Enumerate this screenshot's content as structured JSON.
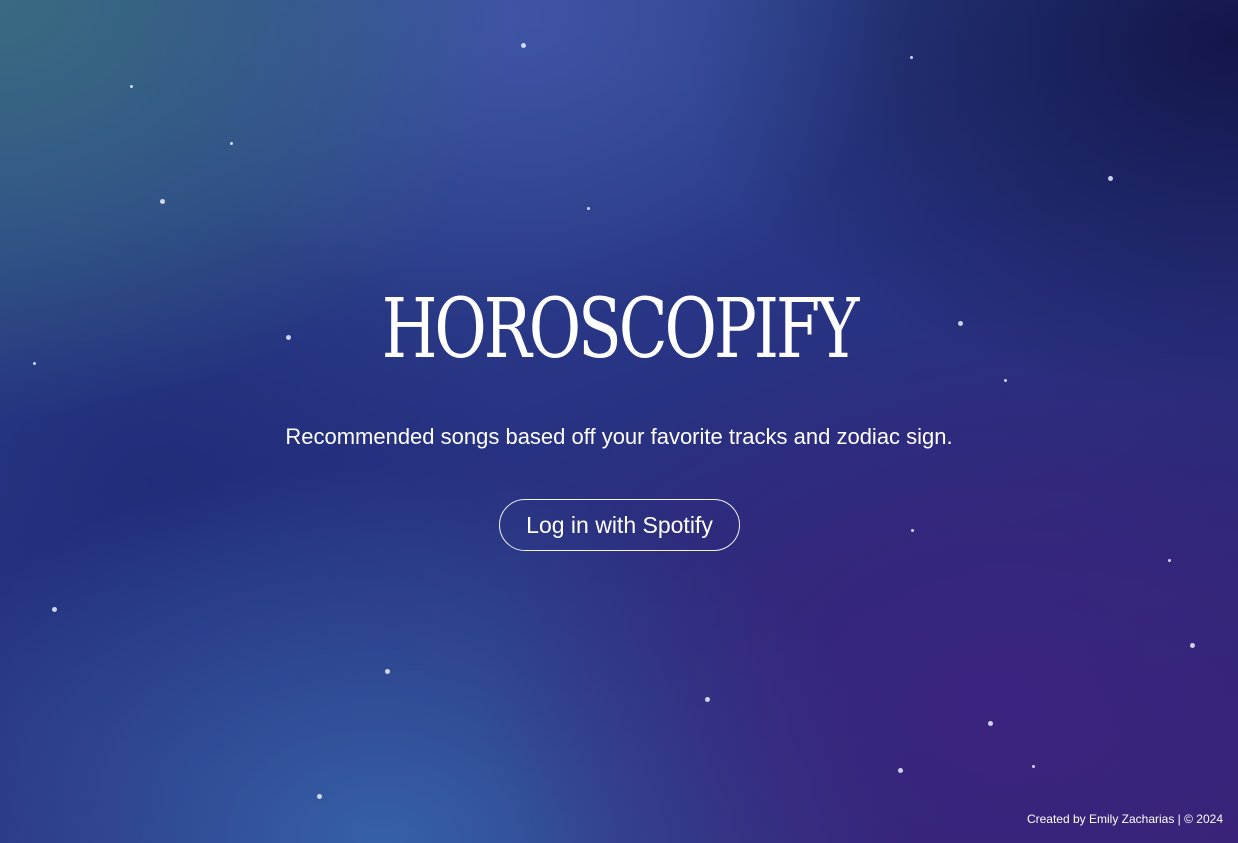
{
  "app": {
    "title": "HOROSCOPIFY",
    "subtitle": "Recommended songs based off your favorite tracks and zodiac sign."
  },
  "actions": {
    "login_label": "Log in with Spotify"
  },
  "footer": {
    "credit": "Created by Emily Zacharias | © 2024"
  },
  "colors": {
    "text": "#ffffff",
    "background_teal": "#3a6c80",
    "background_navy": "#272e7e",
    "background_purple": "#3c2480"
  }
}
